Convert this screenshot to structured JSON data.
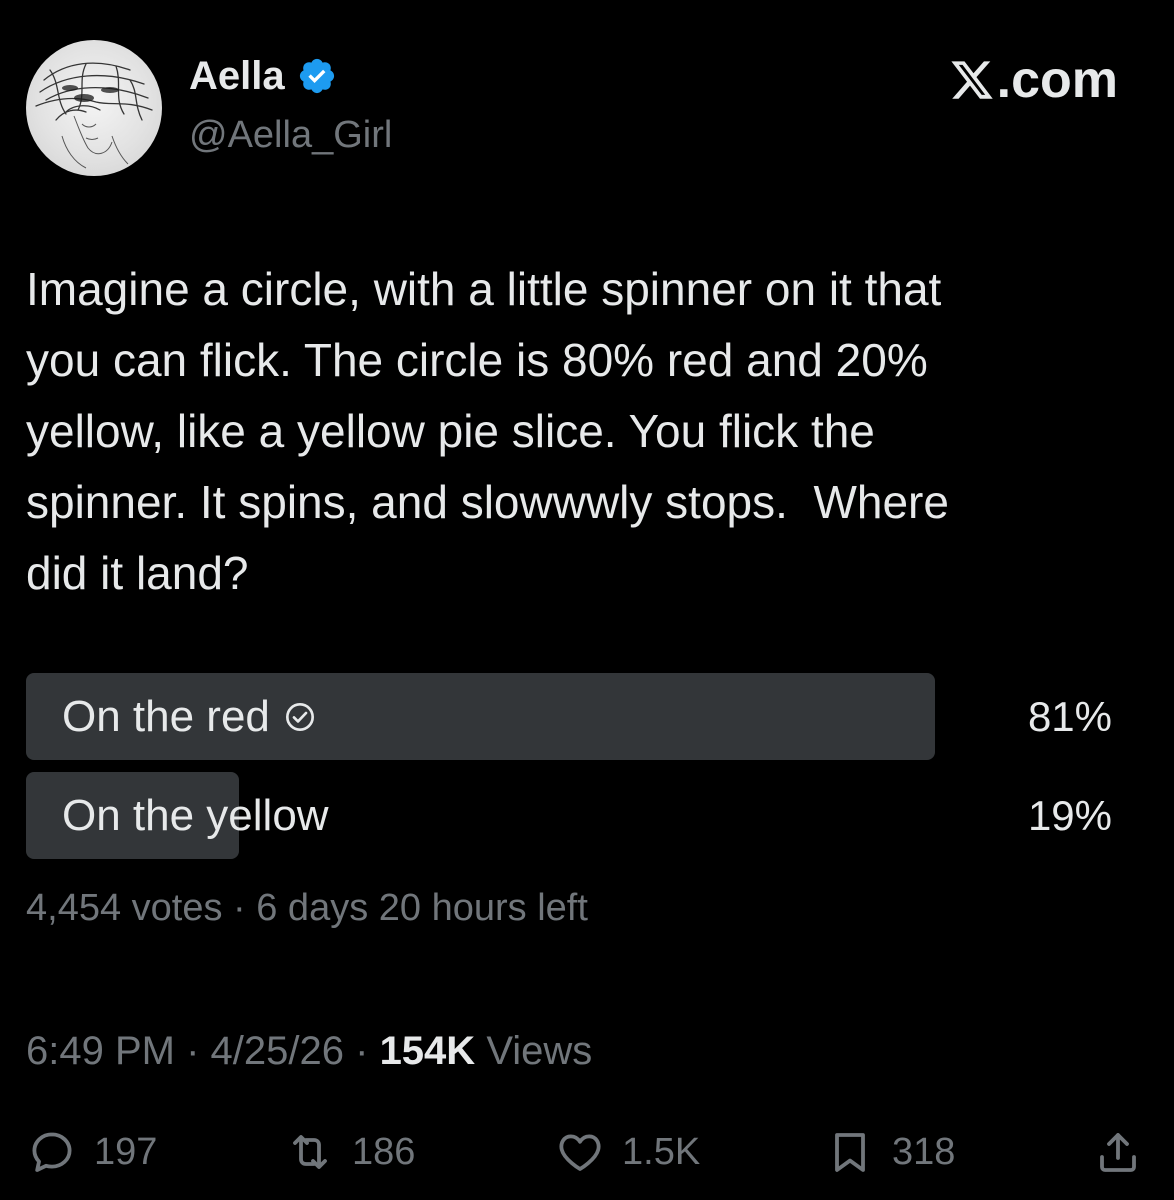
{
  "author": {
    "name": "Aella",
    "handle": "@Aella_Girl",
    "verified_color": "#1d9bf0"
  },
  "brand": {
    "label": ".com",
    "logo_icon": "x-logo-icon"
  },
  "tweet": {
    "text": "Imagine a circle, with a little spinner on it that\nyou can flick. The circle is 80% red and 20%\nyellow, like a yellow pie slice. You flick the\nspinner. It spins, and slowwwly stops.  Where\ndid it land?"
  },
  "poll": {
    "options": [
      {
        "label": "On the red",
        "percent_label": "81%",
        "share": 0.81,
        "selected": true
      },
      {
        "label": "On the yellow",
        "percent_label": "19%",
        "share": 0.19,
        "selected": false
      }
    ],
    "meta": "4,454 votes · 6 days 20 hours left"
  },
  "timestamp": {
    "time": "6:49 PM",
    "date": "4/25/26",
    "views_count": "154K",
    "views_label": "Views"
  },
  "actions": {
    "replies": "197",
    "retweets": "186",
    "likes": "1.5K",
    "bookmarks": "318"
  },
  "colors": {
    "background": "#000000",
    "text_primary": "#e7e9ea",
    "text_secondary": "#71767b",
    "poll_bar": "#333639",
    "verified": "#1d9bf0"
  }
}
